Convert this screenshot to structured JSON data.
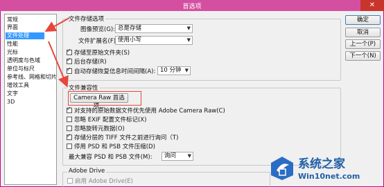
{
  "window": {
    "title": "首选项",
    "close_label": "✕"
  },
  "nav": {
    "items": [
      {
        "label": "常规"
      },
      {
        "label": "界面"
      },
      {
        "label": "文件处理",
        "selected": true
      },
      {
        "label": "性能"
      },
      {
        "label": "光标"
      },
      {
        "label": "透明度与色域"
      },
      {
        "label": "单位与标尺"
      },
      {
        "label": "参考线、网格和切片"
      },
      {
        "label": "增效工具"
      },
      {
        "label": "文字"
      },
      {
        "label": "3D"
      }
    ]
  },
  "file_storage": {
    "title": "文件存储选项",
    "image_preview_label": "图像预览(G):",
    "image_preview_value": "总是存储",
    "file_extension_label": "文件扩展名(F):",
    "file_extension_value": "使用小写",
    "checkboxes": [
      {
        "label": "存储至原始文件夹(S)",
        "checked": true
      },
      {
        "label": "后台存储(R)",
        "checked": true
      },
      {
        "label": "自动存储恢复信息时间间隔(A):",
        "checked": true
      }
    ],
    "interval_value": "10 分钟"
  },
  "compatibility": {
    "title": "文件兼容性",
    "camera_raw_button": "Camera Raw 首选项...",
    "checkboxes": [
      {
        "label": "对支持的原始数据文件优先使用 Adobe Camera Raw(C)",
        "checked": true
      },
      {
        "label": "忽略 EXIF 配置文件标记(X)",
        "checked": false
      },
      {
        "label": "忽略旋转元数据(O)",
        "checked": false
      },
      {
        "label": "存储分层的 TIFF 文件之前进行询问（T)",
        "checked": true
      },
      {
        "label": "停用 PSD 和 PSB 文件压缩(D)",
        "checked": false
      }
    ],
    "max_compat_label": "最大兼容 PSD 和 PSB 文件(M):",
    "max_compat_value": "询问"
  },
  "adobe_drive": {
    "title": "Adobe Drive",
    "enable_label": "启用 Adobe Drive(E)"
  },
  "buttons": {
    "ok": "确定",
    "cancel": "取消",
    "prev": "上一个(P)",
    "next": "下一个(N)"
  },
  "watermark": {
    "line1": "系统之家",
    "line2": "Win10net.com"
  }
}
